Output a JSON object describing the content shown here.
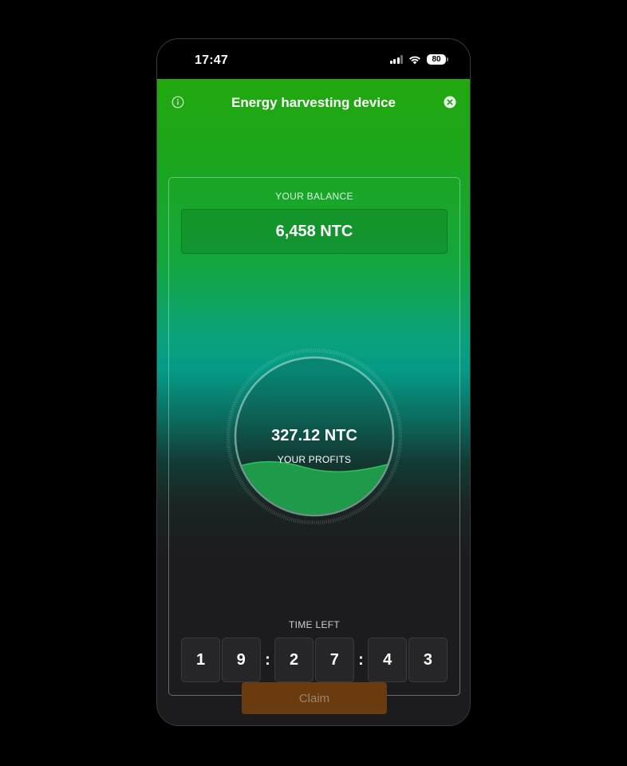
{
  "status_bar": {
    "time": "17:47",
    "battery": "80"
  },
  "header": {
    "title": "Energy harvesting device"
  },
  "balance": {
    "label": "YOUR BALANCE",
    "value": "6,458 NTC"
  },
  "profits": {
    "value": "327.12 NTC",
    "label": "YOUR PROFITS",
    "fill_fraction": 0.3
  },
  "timer": {
    "label": "TIME LEFT",
    "digits": [
      "1",
      "9",
      "2",
      "7",
      "4",
      "3"
    ],
    "separator": ":"
  },
  "claim": {
    "label": "Claim"
  },
  "colors": {
    "accent_green": "#22a80e",
    "teal": "#059a86",
    "claim_button": "#6b3b10",
    "background": "#1c1c1e"
  },
  "icons": {
    "info": "info-icon",
    "close": "close-icon",
    "signal": "signal-icon",
    "wifi": "wifi-icon",
    "battery": "battery-icon"
  }
}
